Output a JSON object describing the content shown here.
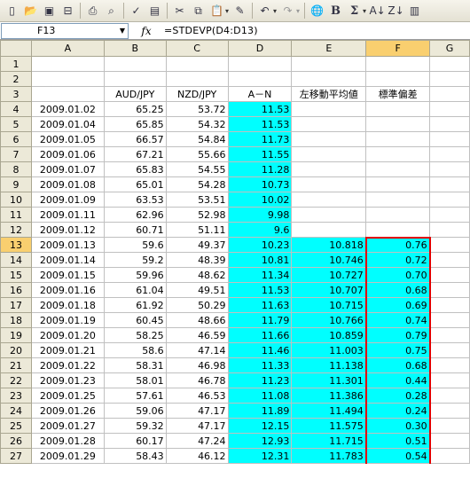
{
  "toolbar": {
    "icons": [
      "new-icon",
      "open-icon",
      "save-icon",
      "permission-icon",
      "print-icon",
      "print-preview-icon",
      "spelling-icon",
      "research-icon",
      "cut-icon",
      "copy-icon",
      "paste-icon",
      "format-painter-icon",
      "undo-icon",
      "redo-icon",
      "hyperlink-icon",
      "bold-icon",
      "autosum-icon",
      "sort-ascending-icon",
      "sort-descending-icon",
      "chart-wizard-icon"
    ]
  },
  "formula_bar": {
    "cell_ref": "F13",
    "fx": "fx",
    "formula": "=STDEVP(D4:D13)"
  },
  "columns": [
    "A",
    "B",
    "C",
    "D",
    "E",
    "F",
    "G"
  ],
  "header_row": {
    "B": "AUD/JPY",
    "C": "NZD/JPY",
    "D": "A－N",
    "E": "左移動平均値",
    "F": "標準偏差"
  },
  "rows": [
    {
      "n": "1",
      "A": "",
      "B": "",
      "C": "",
      "D": "",
      "E": "",
      "F": ""
    },
    {
      "n": "2",
      "A": "",
      "B": "",
      "C": "",
      "D": "",
      "E": "",
      "F": ""
    },
    {
      "n": "3",
      "A": "",
      "B": "AUD/JPY",
      "C": "NZD/JPY",
      "D": "A－N",
      "E": "左移動平均値",
      "F": "標準偏差"
    },
    {
      "n": "4",
      "A": "2009.01.02",
      "B": "65.25",
      "C": "53.72",
      "D": "11.53",
      "E": "",
      "F": ""
    },
    {
      "n": "5",
      "A": "2009.01.04",
      "B": "65.85",
      "C": "54.32",
      "D": "11.53",
      "E": "",
      "F": ""
    },
    {
      "n": "6",
      "A": "2009.01.05",
      "B": "66.57",
      "C": "54.84",
      "D": "11.73",
      "E": "",
      "F": ""
    },
    {
      "n": "7",
      "A": "2009.01.06",
      "B": "67.21",
      "C": "55.66",
      "D": "11.55",
      "E": "",
      "F": ""
    },
    {
      "n": "8",
      "A": "2009.01.07",
      "B": "65.83",
      "C": "54.55",
      "D": "11.28",
      "E": "",
      "F": ""
    },
    {
      "n": "9",
      "A": "2009.01.08",
      "B": "65.01",
      "C": "54.28",
      "D": "10.73",
      "E": "",
      "F": ""
    },
    {
      "n": "10",
      "A": "2009.01.09",
      "B": "63.53",
      "C": "53.51",
      "D": "10.02",
      "E": "",
      "F": ""
    },
    {
      "n": "11",
      "A": "2009.01.11",
      "B": "62.96",
      "C": "52.98",
      "D": "9.98",
      "E": "",
      "F": ""
    },
    {
      "n": "12",
      "A": "2009.01.12",
      "B": "60.71",
      "C": "51.11",
      "D": "9.6",
      "E": "",
      "F": ""
    },
    {
      "n": "13",
      "A": "2009.01.13",
      "B": "59.6",
      "C": "49.37",
      "D": "10.23",
      "E": "10.818",
      "F": "0.76"
    },
    {
      "n": "14",
      "A": "2009.01.14",
      "B": "59.2",
      "C": "48.39",
      "D": "10.81",
      "E": "10.746",
      "F": "0.72"
    },
    {
      "n": "15",
      "A": "2009.01.15",
      "B": "59.96",
      "C": "48.62",
      "D": "11.34",
      "E": "10.727",
      "F": "0.70"
    },
    {
      "n": "16",
      "A": "2009.01.16",
      "B": "61.04",
      "C": "49.51",
      "D": "11.53",
      "E": "10.707",
      "F": "0.68"
    },
    {
      "n": "17",
      "A": "2009.01.18",
      "B": "61.92",
      "C": "50.29",
      "D": "11.63",
      "E": "10.715",
      "F": "0.69"
    },
    {
      "n": "18",
      "A": "2009.01.19",
      "B": "60.45",
      "C": "48.66",
      "D": "11.79",
      "E": "10.766",
      "F": "0.74"
    },
    {
      "n": "19",
      "A": "2009.01.20",
      "B": "58.25",
      "C": "46.59",
      "D": "11.66",
      "E": "10.859",
      "F": "0.79"
    },
    {
      "n": "20",
      "A": "2009.01.21",
      "B": "58.6",
      "C": "47.14",
      "D": "11.46",
      "E": "11.003",
      "F": "0.75"
    },
    {
      "n": "21",
      "A": "2009.01.22",
      "B": "58.31",
      "C": "46.98",
      "D": "11.33",
      "E": "11.138",
      "F": "0.68"
    },
    {
      "n": "22",
      "A": "2009.01.23",
      "B": "58.01",
      "C": "46.78",
      "D": "11.23",
      "E": "11.301",
      "F": "0.44"
    },
    {
      "n": "23",
      "A": "2009.01.25",
      "B": "57.61",
      "C": "46.53",
      "D": "11.08",
      "E": "11.386",
      "F": "0.28"
    },
    {
      "n": "24",
      "A": "2009.01.26",
      "B": "59.06",
      "C": "47.17",
      "D": "11.89",
      "E": "11.494",
      "F": "0.24"
    },
    {
      "n": "25",
      "A": "2009.01.27",
      "B": "59.32",
      "C": "47.17",
      "D": "12.15",
      "E": "11.575",
      "F": "0.30"
    },
    {
      "n": "26",
      "A": "2009.01.28",
      "B": "60.17",
      "C": "47.24",
      "D": "12.93",
      "E": "11.715",
      "F": "0.51"
    },
    {
      "n": "27",
      "A": "2009.01.29",
      "B": "58.43",
      "C": "46.12",
      "D": "12.31",
      "E": "11.783",
      "F": "0.54"
    }
  ],
  "colors": {
    "highlight": "#00ffff",
    "sd_border": "#e00000",
    "header_bg": "#ece9d8",
    "selected_header": "#f9cf6f"
  }
}
